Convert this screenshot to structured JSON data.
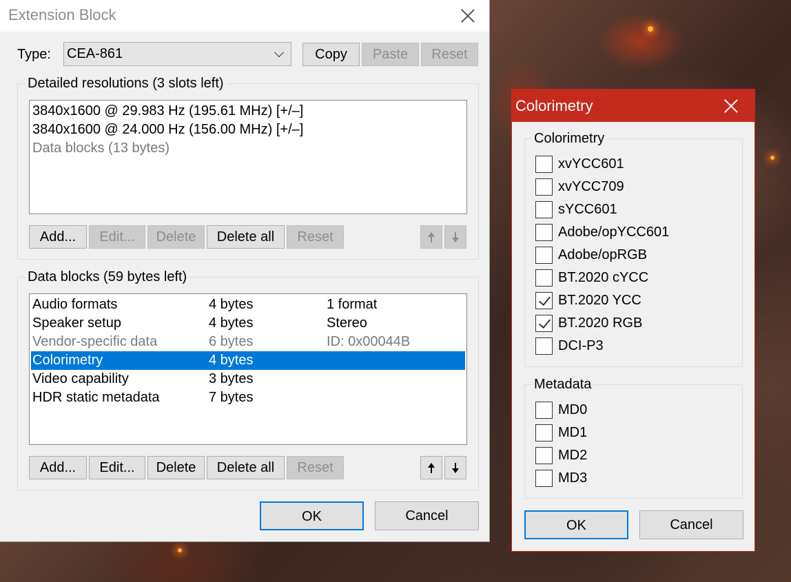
{
  "main_window": {
    "title": "Extension Block",
    "type_label": "Type:",
    "type_value": "CEA-861",
    "buttons": {
      "copy": "Copy",
      "paste": "Paste",
      "reset": "Reset"
    },
    "detailed_resolutions": {
      "heading": "Detailed resolutions (3 slots left)",
      "items": [
        {
          "text": "3840x1600 @ 29.983 Hz (195.61 MHz) [+/–]"
        },
        {
          "text": "3840x1600 @ 24.000 Hz (156.00 MHz) [+/–]"
        },
        {
          "text": "Data blocks (13 bytes)"
        }
      ],
      "buttons": {
        "add": "Add...",
        "edit": "Edit...",
        "delete": "Delete",
        "delete_all": "Delete all",
        "reset": "Reset"
      }
    },
    "data_blocks": {
      "heading": "Data blocks (59 bytes left)",
      "rows": [
        {
          "name": "Audio formats",
          "size": "4 bytes",
          "info": "1 format"
        },
        {
          "name": "Speaker setup",
          "size": "4 bytes",
          "info": "Stereo"
        },
        {
          "name": "Vendor-specific data",
          "size": "6 bytes",
          "info": "ID: 0x00044B"
        },
        {
          "name": "Colorimetry",
          "size": "4 bytes",
          "info": ""
        },
        {
          "name": "Video capability",
          "size": "3 bytes",
          "info": ""
        },
        {
          "name": "HDR static metadata",
          "size": "7 bytes",
          "info": ""
        }
      ],
      "buttons": {
        "add": "Add...",
        "edit": "Edit...",
        "delete": "Delete",
        "delete_all": "Delete all",
        "reset": "Reset"
      }
    },
    "ok": "OK",
    "cancel": "Cancel"
  },
  "colorimetry_dialog": {
    "title": "Colorimetry",
    "colorimetry_group": {
      "heading": "Colorimetry",
      "options": [
        {
          "label": "xvYCC601",
          "checked": false
        },
        {
          "label": "xvYCC709",
          "checked": false
        },
        {
          "label": "sYCC601",
          "checked": false
        },
        {
          "label": "Adobe/opYCC601",
          "checked": false
        },
        {
          "label": "Adobe/opRGB",
          "checked": false
        },
        {
          "label": "BT.2020 cYCC",
          "checked": false
        },
        {
          "label": "BT.2020 YCC",
          "checked": true
        },
        {
          "label": "BT.2020 RGB",
          "checked": true
        },
        {
          "label": "DCI-P3",
          "checked": false
        }
      ]
    },
    "metadata_group": {
      "heading": "Metadata",
      "options": [
        {
          "label": "MD0",
          "checked": false
        },
        {
          "label": "MD1",
          "checked": false
        },
        {
          "label": "MD2",
          "checked": false
        },
        {
          "label": "MD3",
          "checked": false
        }
      ]
    },
    "ok": "OK",
    "cancel": "Cancel"
  },
  "colors": {
    "selection": "#0078d7",
    "dialog_titlebar": "#c42b1c",
    "disabled_text": "#8d8d8d"
  },
  "icons": [
    "close-icon",
    "chevron-down-icon",
    "arrow-up-icon",
    "arrow-down-icon",
    "checkmark-icon"
  ]
}
